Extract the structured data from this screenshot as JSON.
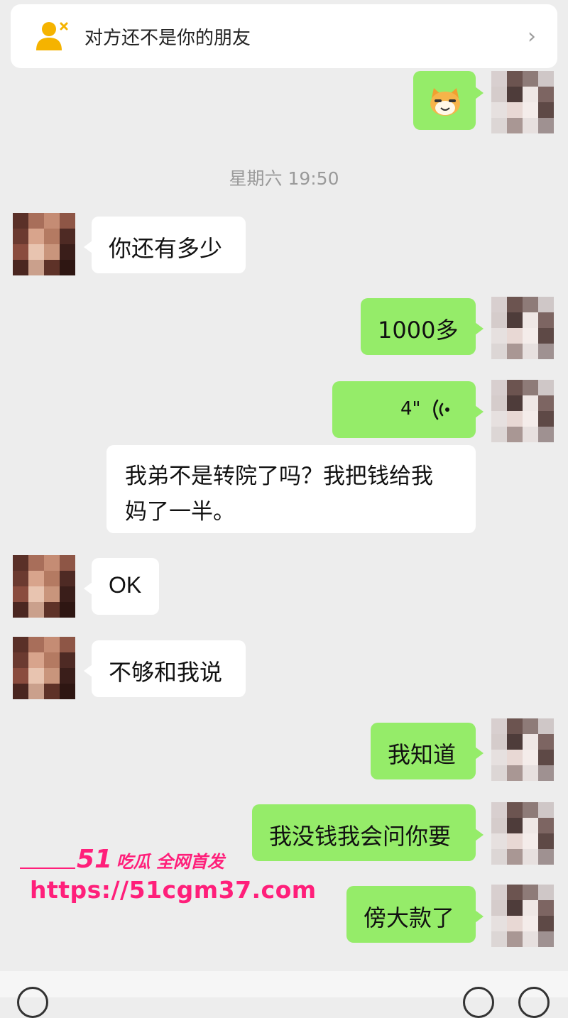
{
  "banner": {
    "text": "对方还不是你的朋友",
    "chevron": "›",
    "icon": "add-friend-person-icon"
  },
  "timestamp": "星期六 19:50",
  "messages": [
    {
      "side": "out",
      "type": "sticker",
      "sticker": "cat-emoji-sticker"
    },
    {
      "side": "in",
      "type": "text",
      "text": "你还有多少"
    },
    {
      "side": "out",
      "type": "text",
      "text": "1000多"
    },
    {
      "side": "out",
      "type": "voice",
      "duration": "4\""
    },
    {
      "side": "in",
      "type": "text",
      "line1": "我弟不是转院了吗？我把钱给我",
      "line2": "妈了一半。"
    },
    {
      "side": "in",
      "type": "text",
      "text": "OK"
    },
    {
      "side": "in",
      "type": "text",
      "text": "不够和我说"
    },
    {
      "side": "out",
      "type": "text",
      "text": "我知道"
    },
    {
      "side": "out",
      "type": "text",
      "text": "我没钱我会问你要"
    },
    {
      "side": "out",
      "type": "text",
      "text": "傍大款了"
    }
  ],
  "watermark": {
    "num": "51",
    "title": "吃瓜 全网首发",
    "url": "https://51cgm37.com"
  },
  "colors": {
    "outgoing_bubble": "#95ec69",
    "incoming_bubble": "#ffffff",
    "background": "#ededed",
    "watermark": "#ff1f7a",
    "banner_icon": "#f5b300"
  }
}
